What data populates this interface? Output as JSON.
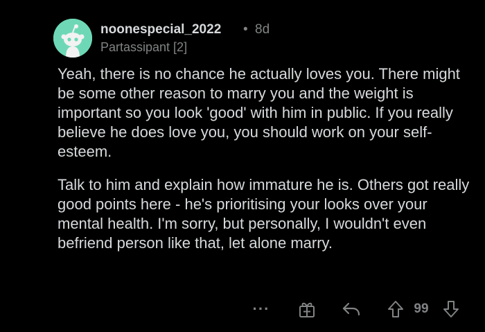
{
  "comment": {
    "username": "noonespecial_2022",
    "separator": "•",
    "time_ago": "8d",
    "flair": "Partassipant [2]",
    "paragraphs": [
      "Yeah, there is no chance he actually loves you. There might be some other reason to marry you and the weight is important so you look 'good' with him in public. If you really believe he does love you, you should work on your self-esteem.",
      "Talk to him and explain how immature he is. Others got really good points here - he's prioritising your looks over your mental health. I'm sorry, but personally, I wouldn't even befriend person like that, let alone marry."
    ],
    "actions": {
      "more_label": "···",
      "score": "99"
    }
  },
  "colors": {
    "background": "#000000",
    "text": "#d7dadc",
    "meta": "#818384",
    "avatar_bg": "#6ed8b6"
  },
  "icons": [
    "snoo-avatar-icon",
    "more-options-icon",
    "award-icon",
    "reply-icon",
    "upvote-icon",
    "downvote-icon"
  ]
}
